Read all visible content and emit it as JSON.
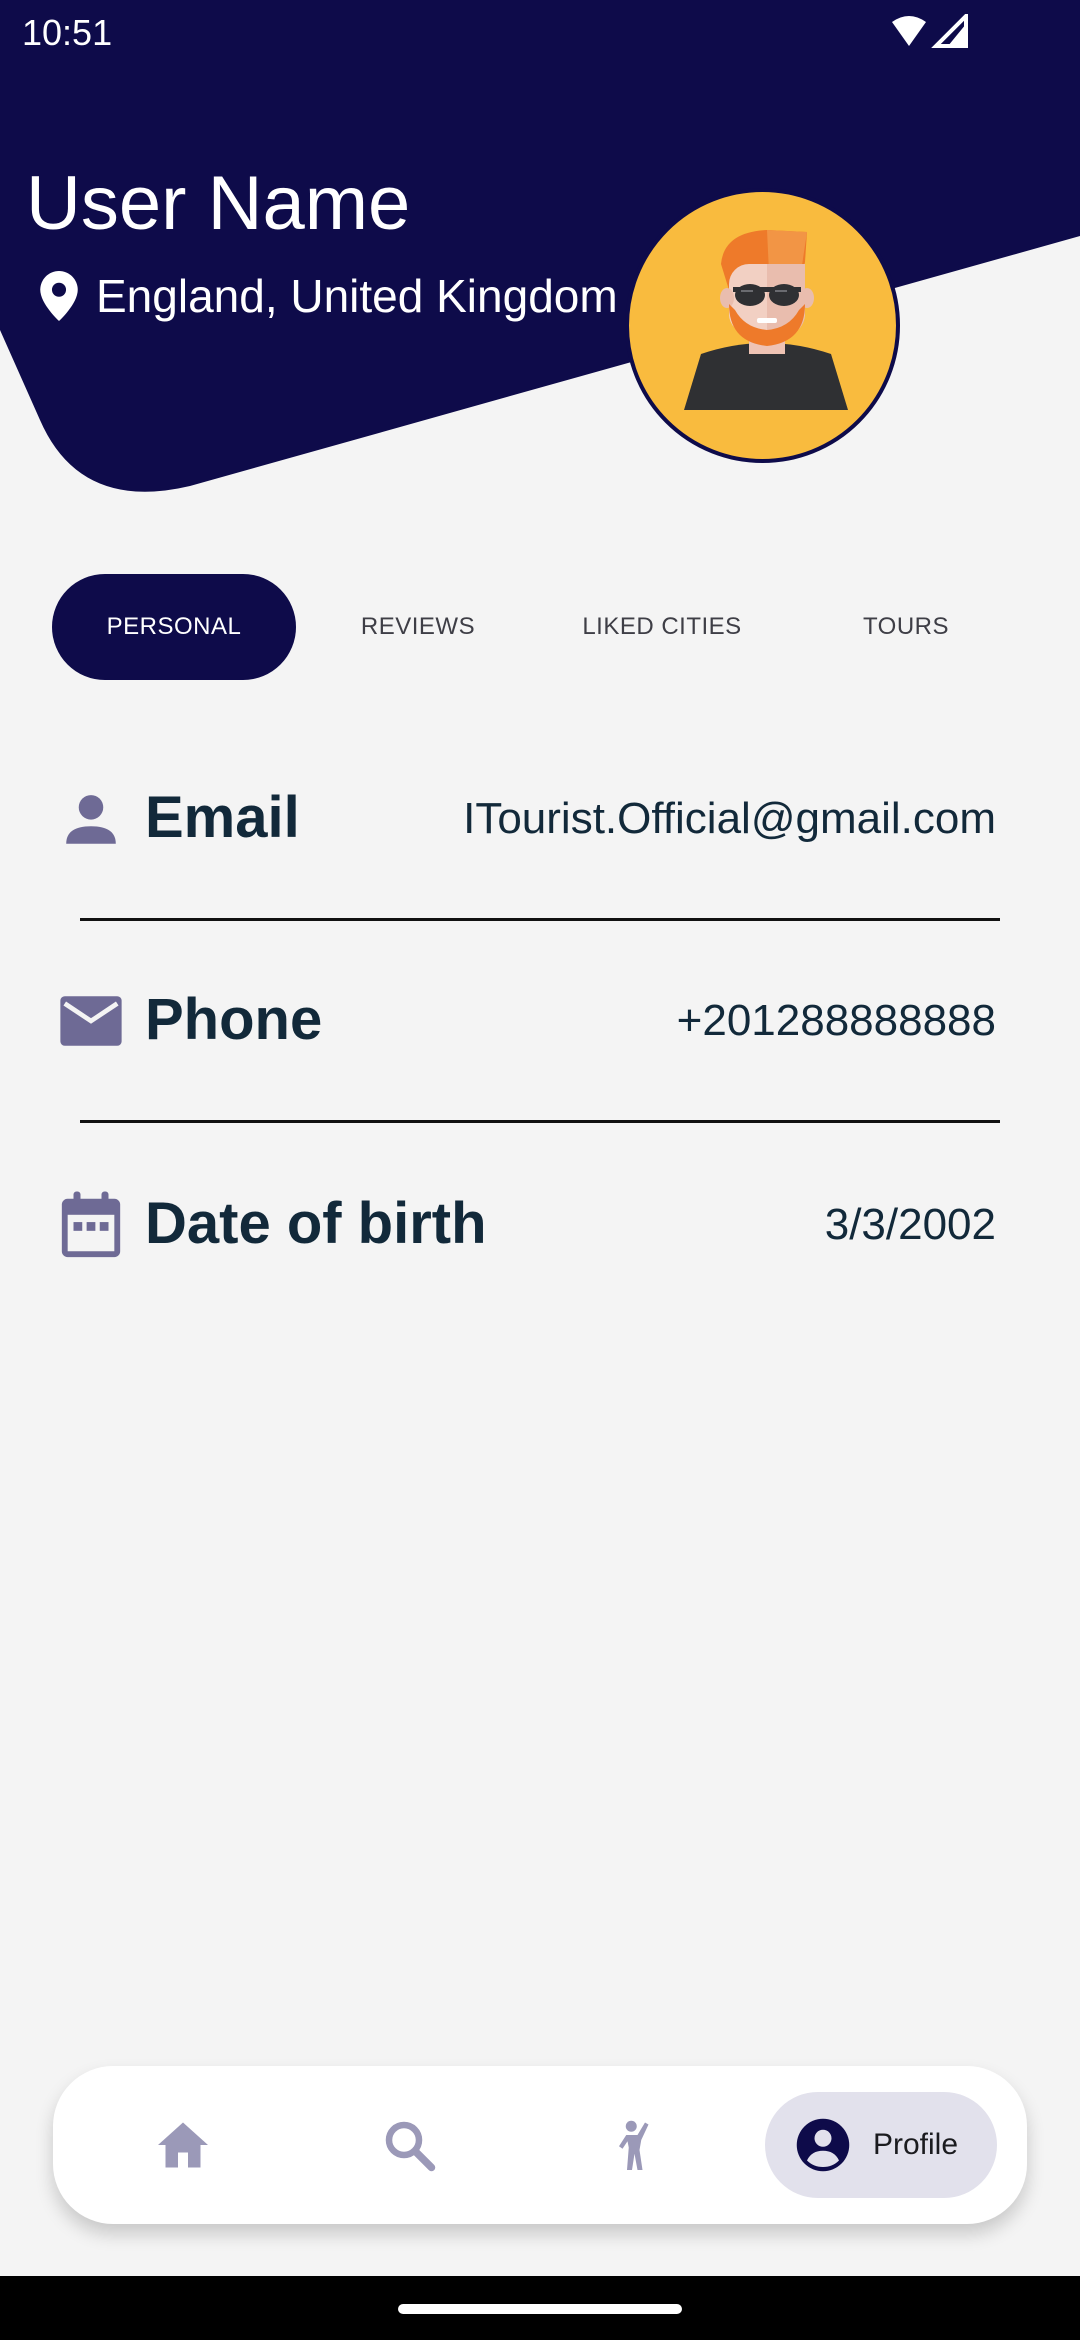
{
  "status_bar": {
    "time": "10:51"
  },
  "header": {
    "user_name": "User Name",
    "location": "England, United Kingdom",
    "navy_color": "#0e0b4a",
    "avatar_bg": "#f9bb3e"
  },
  "tabs": [
    {
      "label": "PERSONAL",
      "active": true
    },
    {
      "label": "REVIEWS",
      "active": false
    },
    {
      "label": "LIKED CITIES",
      "active": false
    },
    {
      "label": "TOURS",
      "active": false
    }
  ],
  "info": {
    "email": {
      "label": "Email",
      "value": "ITourist.Official@gmail.com",
      "icon": "person-icon"
    },
    "phone": {
      "label": "Phone",
      "value": "+201288888888",
      "icon": "mail-icon"
    },
    "dob": {
      "label": "Date of birth",
      "value": "3/3/2002",
      "icon": "calendar-icon"
    }
  },
  "bottom_nav": {
    "items": [
      {
        "icon": "home-icon"
      },
      {
        "icon": "search-icon"
      },
      {
        "icon": "tourist-icon"
      },
      {
        "icon": "account-circle-icon",
        "label": "Profile",
        "active": true
      }
    ]
  }
}
